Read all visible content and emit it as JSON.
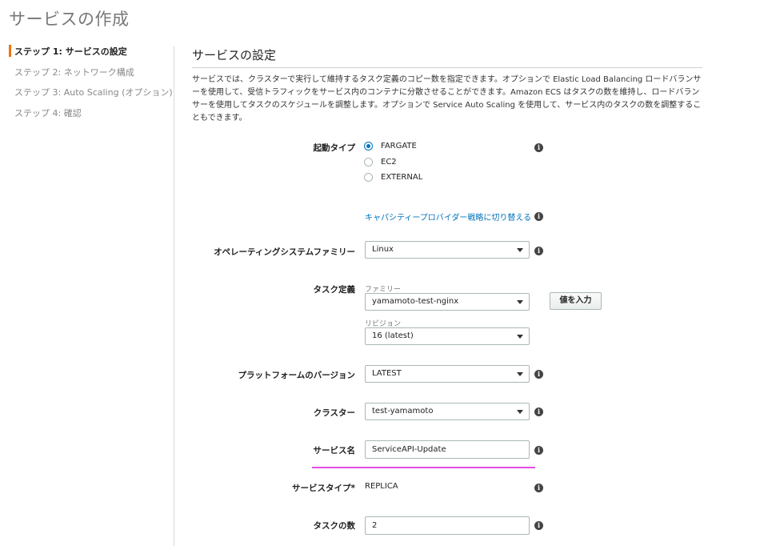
{
  "page_title": "サービスの作成",
  "steps": [
    {
      "label": "ステップ 1: サービスの設定",
      "active": true
    },
    {
      "label": "ステップ 2: ネットワーク構成",
      "active": false
    },
    {
      "label": "ステップ 3: Auto Scaling (オプション)",
      "active": false
    },
    {
      "label": "ステップ 4: 確認",
      "active": false
    }
  ],
  "section": {
    "title": "サービスの設定",
    "description": "サービスでは、クラスターで実行して維持するタスク定義のコピー数を指定できます。オプションで Elastic Load Balancing ロードバランサーを使用して、受信トラフィックをサービス内のコンテナに分散させることができます。Amazon ECS はタスクの数を維持し、ロードバランサーを使用してタスクのスケジュールを調整します。オプションで Service Auto Scaling を使用して、サービス内のタスクの数を調整することもできます。"
  },
  "launch_type": {
    "label": "起動タイプ",
    "options": [
      "FARGATE",
      "EC2",
      "EXTERNAL"
    ],
    "selected": "FARGATE",
    "capacity_link": "キャパシティープロバイダー戦略に切り替える"
  },
  "os_family": {
    "label": "オペレーティングシステムファミリー",
    "value": "Linux"
  },
  "task_definition": {
    "label": "タスク定義",
    "family_label": "ファミリー",
    "family_value": "yamamoto-test-nginx",
    "enter_value_button": "値を入力",
    "revision_label": "リビジョン",
    "revision_value": "16 (latest)"
  },
  "platform_version": {
    "label": "プラットフォームのバージョン",
    "value": "LATEST"
  },
  "cluster": {
    "label": "クラスター",
    "value": "test-yamamoto"
  },
  "service_name": {
    "label": "サービス名",
    "value": "ServiceAPI-Update"
  },
  "service_type": {
    "label": "サービスタイプ*",
    "value": "REPLICA"
  },
  "task_count": {
    "label": "タスクの数",
    "value": "2"
  },
  "colors": {
    "accent": "#ec7211",
    "link": "#0073bb",
    "highlight": "#e04ee6"
  },
  "icons": {
    "info": "i"
  }
}
